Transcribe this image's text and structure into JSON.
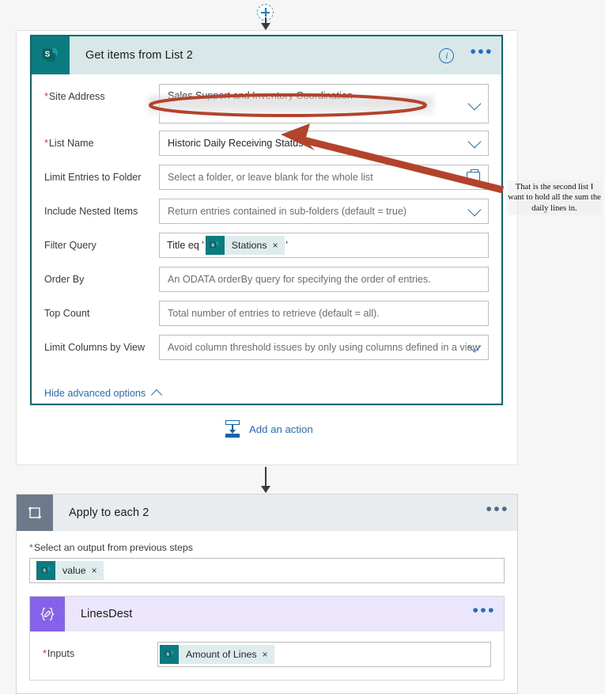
{
  "top": {
    "add_step_icon": "plus-circle-icon"
  },
  "sharepoint_card": {
    "title": "Get items from List 2",
    "icon": "sharepoint-icon",
    "info_icon": "i",
    "menu": "•••",
    "fields": [
      {
        "label": "Site Address",
        "required": true,
        "value": "Sales Support and Inventory Coordination -",
        "control": "dropdown-redacted"
      },
      {
        "label": "List Name",
        "required": true,
        "value": "Historic Daily Receiving Status",
        "control": "dropdown"
      },
      {
        "label": "Limit Entries to Folder",
        "required": false,
        "placeholder": "Select a folder, or leave blank for the whole list",
        "control": "folder-picker"
      },
      {
        "label": "Include Nested Items",
        "required": false,
        "placeholder": "Return entries contained in sub-folders (default = true)",
        "control": "dropdown"
      },
      {
        "label": "Filter Query",
        "required": false,
        "control": "token-query",
        "query_prefix": "Title eq '",
        "query_suffix": "'",
        "token": {
          "label": "Stations",
          "icon": "sharepoint-icon",
          "remove": "×"
        }
      },
      {
        "label": "Order By",
        "required": false,
        "placeholder": "An ODATA orderBy query for specifying the order of entries.",
        "control": "text"
      },
      {
        "label": "Top Count",
        "required": false,
        "placeholder": "Total number of entries to retrieve (default = all).",
        "control": "text"
      },
      {
        "label": "Limit Columns by View",
        "required": false,
        "placeholder": "Avoid column threshold issues by only using columns defined in a view",
        "control": "dropdown"
      }
    ],
    "advanced_toggle": "Hide advanced options"
  },
  "add_action": {
    "label": "Add an action",
    "icon": "add-action-icon"
  },
  "loop_card": {
    "title": "Apply to each 2",
    "icon": "loop-icon",
    "menu": "•••",
    "input_label": "Select an output from previous steps",
    "input_required": true,
    "token": {
      "label": "value",
      "icon": "sharepoint-icon",
      "remove": "×"
    }
  },
  "compose_card": {
    "title": "LinesDest",
    "icon": "compose-icon",
    "menu": "•••",
    "input_label": "Inputs",
    "input_required": true,
    "token": {
      "label": "Amount of Lines",
      "icon": "sharepoint-icon",
      "remove": "×"
    }
  },
  "annotation": {
    "note": "That is the second list I want to hold all the sum the daily lines in.",
    "arrow_color": "#b4432c",
    "ellipse_color": "#b4432c"
  },
  "colors": {
    "sharepoint_teal": "#036c70",
    "header_teal": "#d9e7e8",
    "link_blue": "#1f6fc4",
    "loop_gray": "#6d7a8c",
    "compose_purple": "#8662e8",
    "page_background": "#f6f6f6"
  }
}
